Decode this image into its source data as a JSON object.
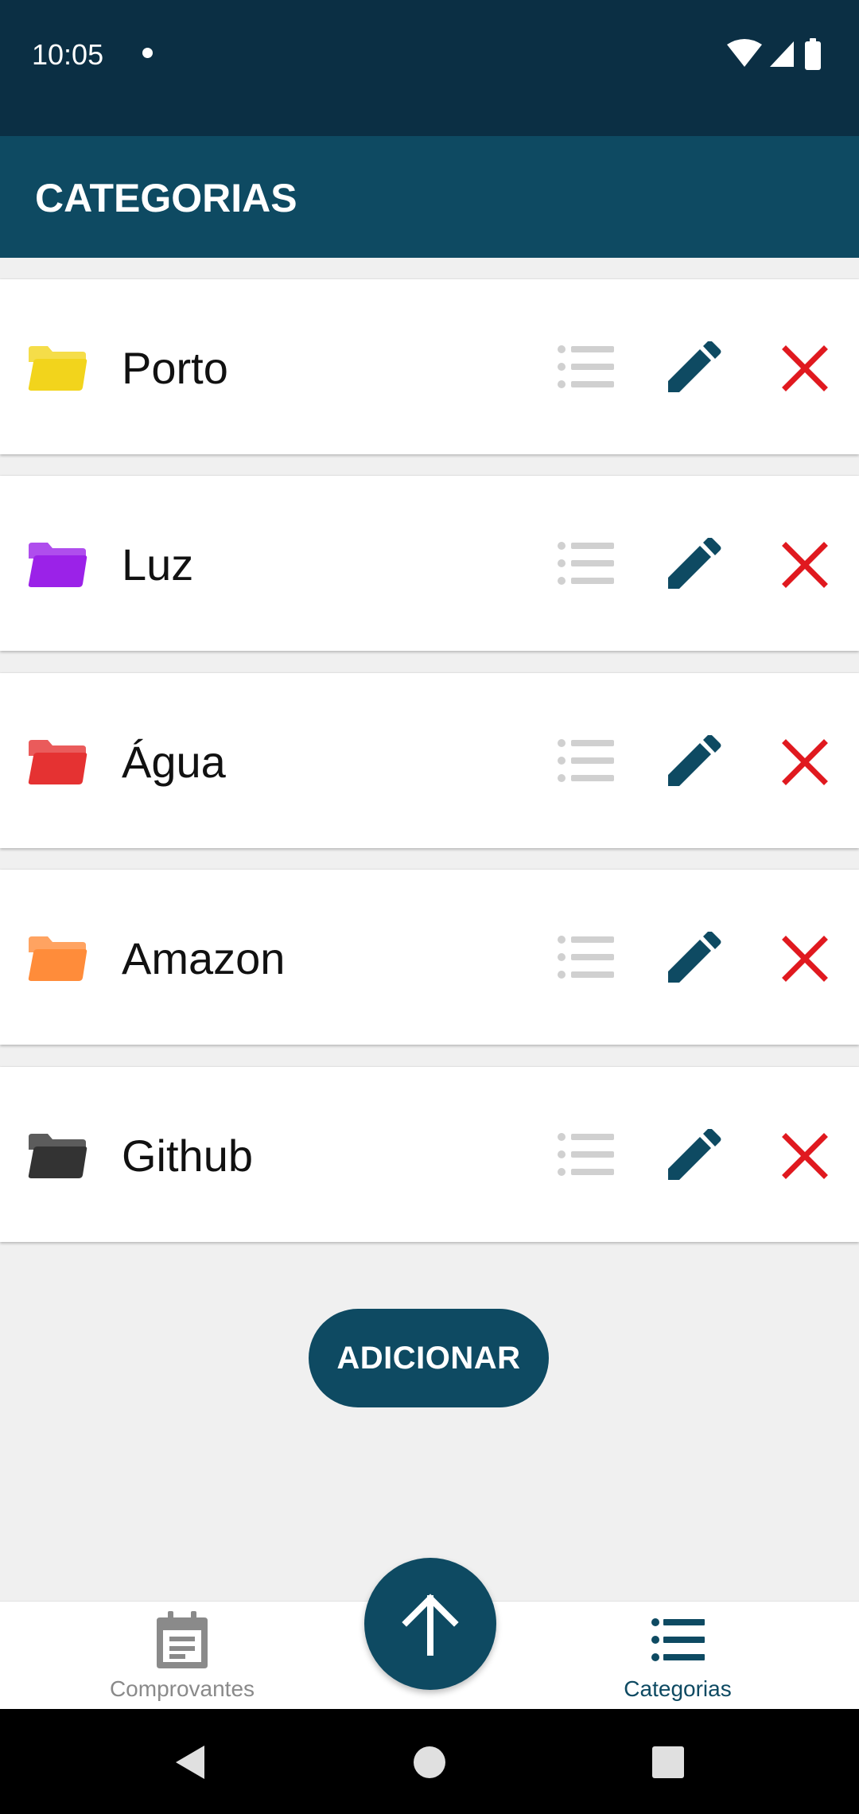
{
  "status_bar": {
    "time": "10:05",
    "icons": [
      "notification-dot-icon",
      "wifi-icon",
      "signal-icon",
      "battery-icon"
    ]
  },
  "app_bar": {
    "title": "CATEGORIAS"
  },
  "categories": [
    {
      "name": "Porto",
      "folder_color": "#f2d41c"
    },
    {
      "name": "Luz",
      "folder_color": "#9b22e8"
    },
    {
      "name": "Água",
      "folder_color": "#e53232"
    },
    {
      "name": "Amazon",
      "folder_color": "#ff8c3a"
    },
    {
      "name": "Github",
      "folder_color": "#333333"
    }
  ],
  "row_actions": {
    "icons": [
      "list-icon",
      "edit-pencil-icon",
      "delete-x-icon"
    ],
    "list_icon_color": "#d0d0d0",
    "edit_icon_color": "#0e4a62",
    "delete_icon_color": "#e0191f"
  },
  "add_button": {
    "label": "ADICIONAR"
  },
  "bottom_nav": {
    "items": [
      {
        "label": "Comprovantes",
        "icon": "receipt-icon",
        "active": false
      },
      {
        "label": "Categorias",
        "icon": "list-icon",
        "active": true
      }
    ],
    "fab_icon": "arrow-up-icon",
    "active_color": "#0e4a62",
    "inactive_color": "#8a8a8a"
  },
  "system_nav": {
    "icons": [
      "back-icon",
      "home-icon",
      "recents-icon"
    ]
  },
  "colors": {
    "status_bar": "#0b2f44",
    "primary": "#0e4a62",
    "background": "#f0f0f0"
  }
}
